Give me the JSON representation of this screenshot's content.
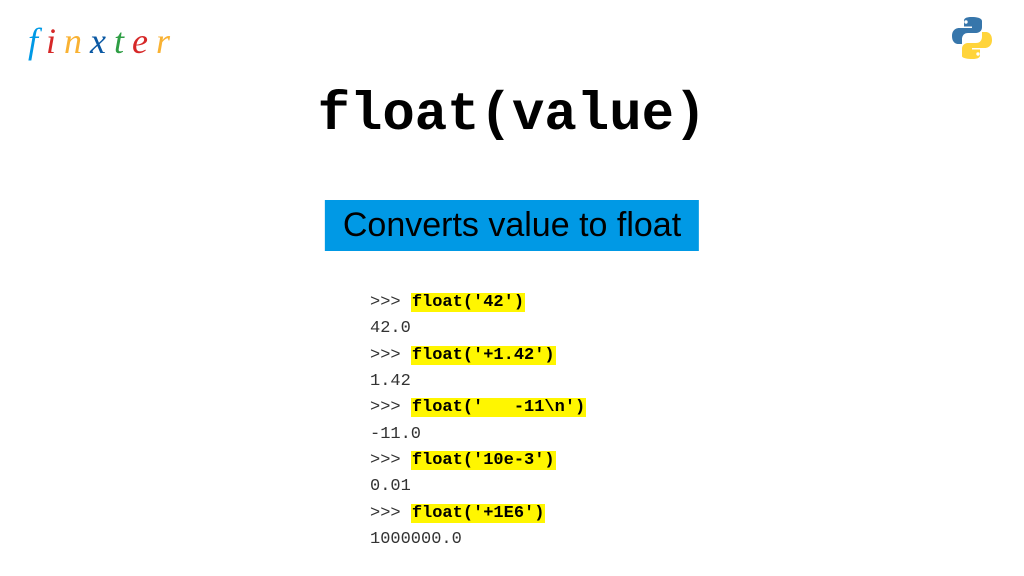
{
  "logo": {
    "letters": [
      {
        "ch": "f",
        "color": "#0099e5"
      },
      {
        "ch": "i",
        "color": "#d62828"
      },
      {
        "ch": "n",
        "color": "#f9b233"
      },
      {
        "ch": "x",
        "color": "#0a58a3"
      },
      {
        "ch": "t",
        "color": "#2e9e44"
      },
      {
        "ch": "e",
        "color": "#d62828"
      },
      {
        "ch": "r",
        "color": "#f9b233"
      }
    ]
  },
  "title": "float(value)",
  "subtitle": "Converts value to float",
  "code": {
    "prompt": ">>> ",
    "lines": [
      {
        "call": "float('42')",
        "out": "42.0"
      },
      {
        "call": "float('+1.42')",
        "out": "1.42"
      },
      {
        "call": "float('   -11\\n')",
        "out": "-11.0"
      },
      {
        "call": "float('10e-3')",
        "out": "0.01"
      },
      {
        "call": "float('+1E6')",
        "out": "1000000.0"
      }
    ]
  },
  "icons": {
    "python": "python-logo"
  }
}
